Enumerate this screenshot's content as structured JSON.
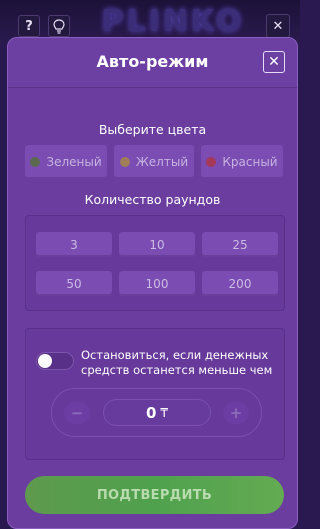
{
  "topbar": {
    "help_label": "?",
    "hint_icon": "lightbulb-icon",
    "logo_text": "PLINKO",
    "exit_label": "✕"
  },
  "modal": {
    "title": "Авто-режим",
    "close_label": "✕"
  },
  "colors": {
    "title": "Выберите цвета",
    "options": [
      {
        "label": "Зеленый",
        "dot_color": "#5b6a4f"
      },
      {
        "label": "Желтый",
        "dot_color": "#a07e5a"
      },
      {
        "label": "Красный",
        "dot_color": "#a5395a"
      }
    ]
  },
  "rounds": {
    "title": "Количество раундов",
    "options": [
      "3",
      "10",
      "25",
      "50",
      "100",
      "200"
    ]
  },
  "stop": {
    "label": "Остановиться, если денежных средств останется меньше чем",
    "toggle_on": false,
    "amount": "0",
    "currency": "₸",
    "minus_label": "−",
    "plus_label": "+"
  },
  "confirm_label": "ПОДТВЕРДИТЬ",
  "accent_colors": {
    "modal_bg": "#6a3d9e",
    "button_bg": "#7b4cb2",
    "confirm_green": "#4fa14e"
  }
}
